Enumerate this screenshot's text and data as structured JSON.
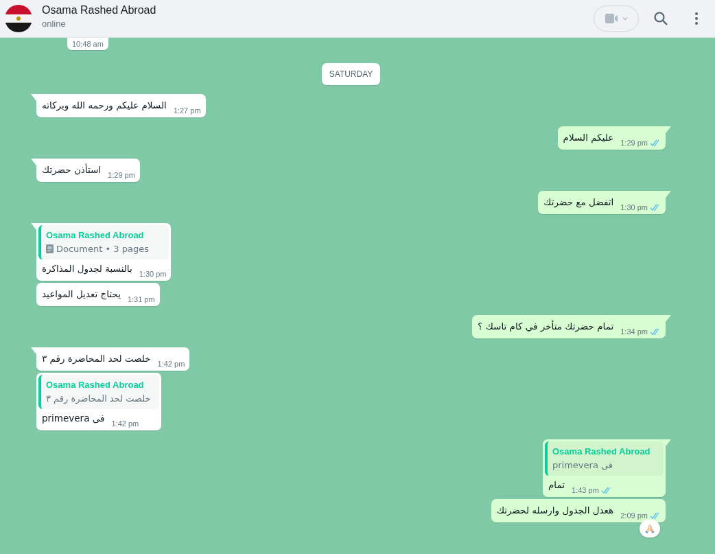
{
  "header": {
    "name": "Osama Rashed Abroad",
    "status": "online"
  },
  "messages": [
    {
      "kind": "partial",
      "outgoing": false,
      "time": "10:48 am"
    },
    {
      "kind": "date",
      "text": "SATURDAY"
    },
    {
      "kind": "text",
      "outgoing": false,
      "tail": true,
      "text": "السلام عليكم ورحمه الله وبركاته",
      "time": "1:27 pm"
    },
    {
      "kind": "text",
      "outgoing": true,
      "tail": true,
      "text": "عليكم السلام",
      "time": "1:29 pm",
      "read": true
    },
    {
      "kind": "text",
      "outgoing": false,
      "tail": true,
      "text": "استأذن حضرتك",
      "time": "1:29 pm"
    },
    {
      "kind": "text",
      "outgoing": true,
      "tail": true,
      "text": "اتفضل مع حضرتك",
      "time": "1:30 pm",
      "read": true
    },
    {
      "kind": "reply",
      "outgoing": false,
      "tail": true,
      "quote": {
        "author": "Osama Rashed Abroad",
        "kind": "document",
        "text": "Document • 3 pages"
      },
      "text": "بالنسبة لجدول المذاكرة",
      "time": "1:30 pm"
    },
    {
      "kind": "text",
      "outgoing": false,
      "tail": false,
      "text": "يحتاج تعديل المواعيد",
      "time": "1:31 pm"
    },
    {
      "kind": "text",
      "outgoing": true,
      "tail": true,
      "text": "تمام حضرتك متأخر في كام تاسك ؟",
      "time": "1:34 pm",
      "read": true
    },
    {
      "kind": "text",
      "outgoing": false,
      "tail": true,
      "text": "خلصت لحد المحاضرة رقم ٣",
      "time": "1:42 pm"
    },
    {
      "kind": "reply",
      "outgoing": false,
      "tail": false,
      "quote": {
        "author": "Osama Rashed Abroad",
        "kind": "text",
        "text": "خلصت لحد المحاضرة رقم ٣"
      },
      "text": "فى primevera",
      "time": "1:42 pm"
    },
    {
      "kind": "reply",
      "outgoing": true,
      "tail": true,
      "quote": {
        "author": "Osama Rashed Abroad",
        "kind": "text",
        "text": "فى primevera"
      },
      "text": "تمام",
      "time": "1:43 pm",
      "read": true
    },
    {
      "kind": "text",
      "outgoing": true,
      "tail": false,
      "text": "هعدل الجدول وارسله لحضرتك",
      "time": "2:09 pm",
      "read": true,
      "reaction": true
    }
  ]
}
